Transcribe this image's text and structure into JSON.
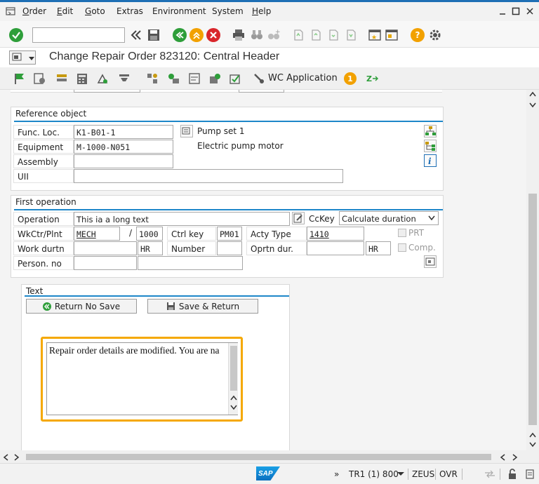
{
  "menu": {
    "items": [
      {
        "label": "Order",
        "key": "O",
        "rest": "rder"
      },
      {
        "label": "Edit",
        "key": "E",
        "rest": "dit"
      },
      {
        "label": "Goto",
        "key": "G",
        "rest": "oto"
      },
      {
        "label": "Extras",
        "key": "",
        "rest": "Extras"
      },
      {
        "label": "Environment",
        "key": "",
        "rest": "Environment"
      },
      {
        "label": "System",
        "key": "",
        "rest": "System"
      },
      {
        "label": "Help",
        "key": "H",
        "rest": "elp"
      }
    ]
  },
  "toolbar": {
    "command_value": "",
    "help_glyph": "?"
  },
  "title": "Change Repair Order 823120: Central Header",
  "apptoolbar": {
    "wc_label": "WC Application",
    "badge": "1"
  },
  "reference": {
    "title": "Reference object",
    "funcloc_label": "Func. Loc.",
    "funcloc_value": "K1-B01-1",
    "funcloc_desc": "Pump set 1",
    "equipment_label": "Equipment",
    "equipment_value": "M-1000-N051",
    "equipment_desc": "Electric pump motor",
    "assembly_label": "Assembly",
    "assembly_value": "",
    "uii_label": "UII",
    "uii_value": ""
  },
  "operation": {
    "title": "First operation",
    "operation_label": "Operation",
    "operation_value": "This ia a long text",
    "cckey_label": "CcKey",
    "cckey_value": "Calculate duration",
    "wkctr_label": "WkCtr/Plnt",
    "wkctr_value": "MECH",
    "slash": "/",
    "plant_value": "1000",
    "ctrlkey_label": "Ctrl key",
    "ctrlkey_value": "PM01",
    "actytype_label": "Acty Type",
    "actytype_value": "1410",
    "prt_label": "PRT",
    "workdurtn_label": "Work durtn",
    "workdurtn_value": "",
    "workdurtn_unit": "HR",
    "number_label": "Number",
    "number_value": "",
    "oprtndur_label": "Oprtn dur.",
    "oprtndur_value": "",
    "oprtndur_unit": "HR",
    "comp_label": "Comp.",
    "personno_label": "Person. no",
    "personno_value": "",
    "personno_desc": ""
  },
  "text": {
    "title": "Text",
    "return_no_save": "Return No Save",
    "save_return": "Save & Return",
    "editor_content": "Repair order details are modified. You are na"
  },
  "status": {
    "system": "TR1 (1) 800",
    "server": "ZEUS",
    "mode": "OVR",
    "chevron": "»",
    "logo": "SAP"
  },
  "colors": {
    "accent": "#1e87c9",
    "highlight": "#f5a800",
    "green": "#2e9e3a",
    "red": "#d9262b",
    "orange": "#f2a100"
  }
}
